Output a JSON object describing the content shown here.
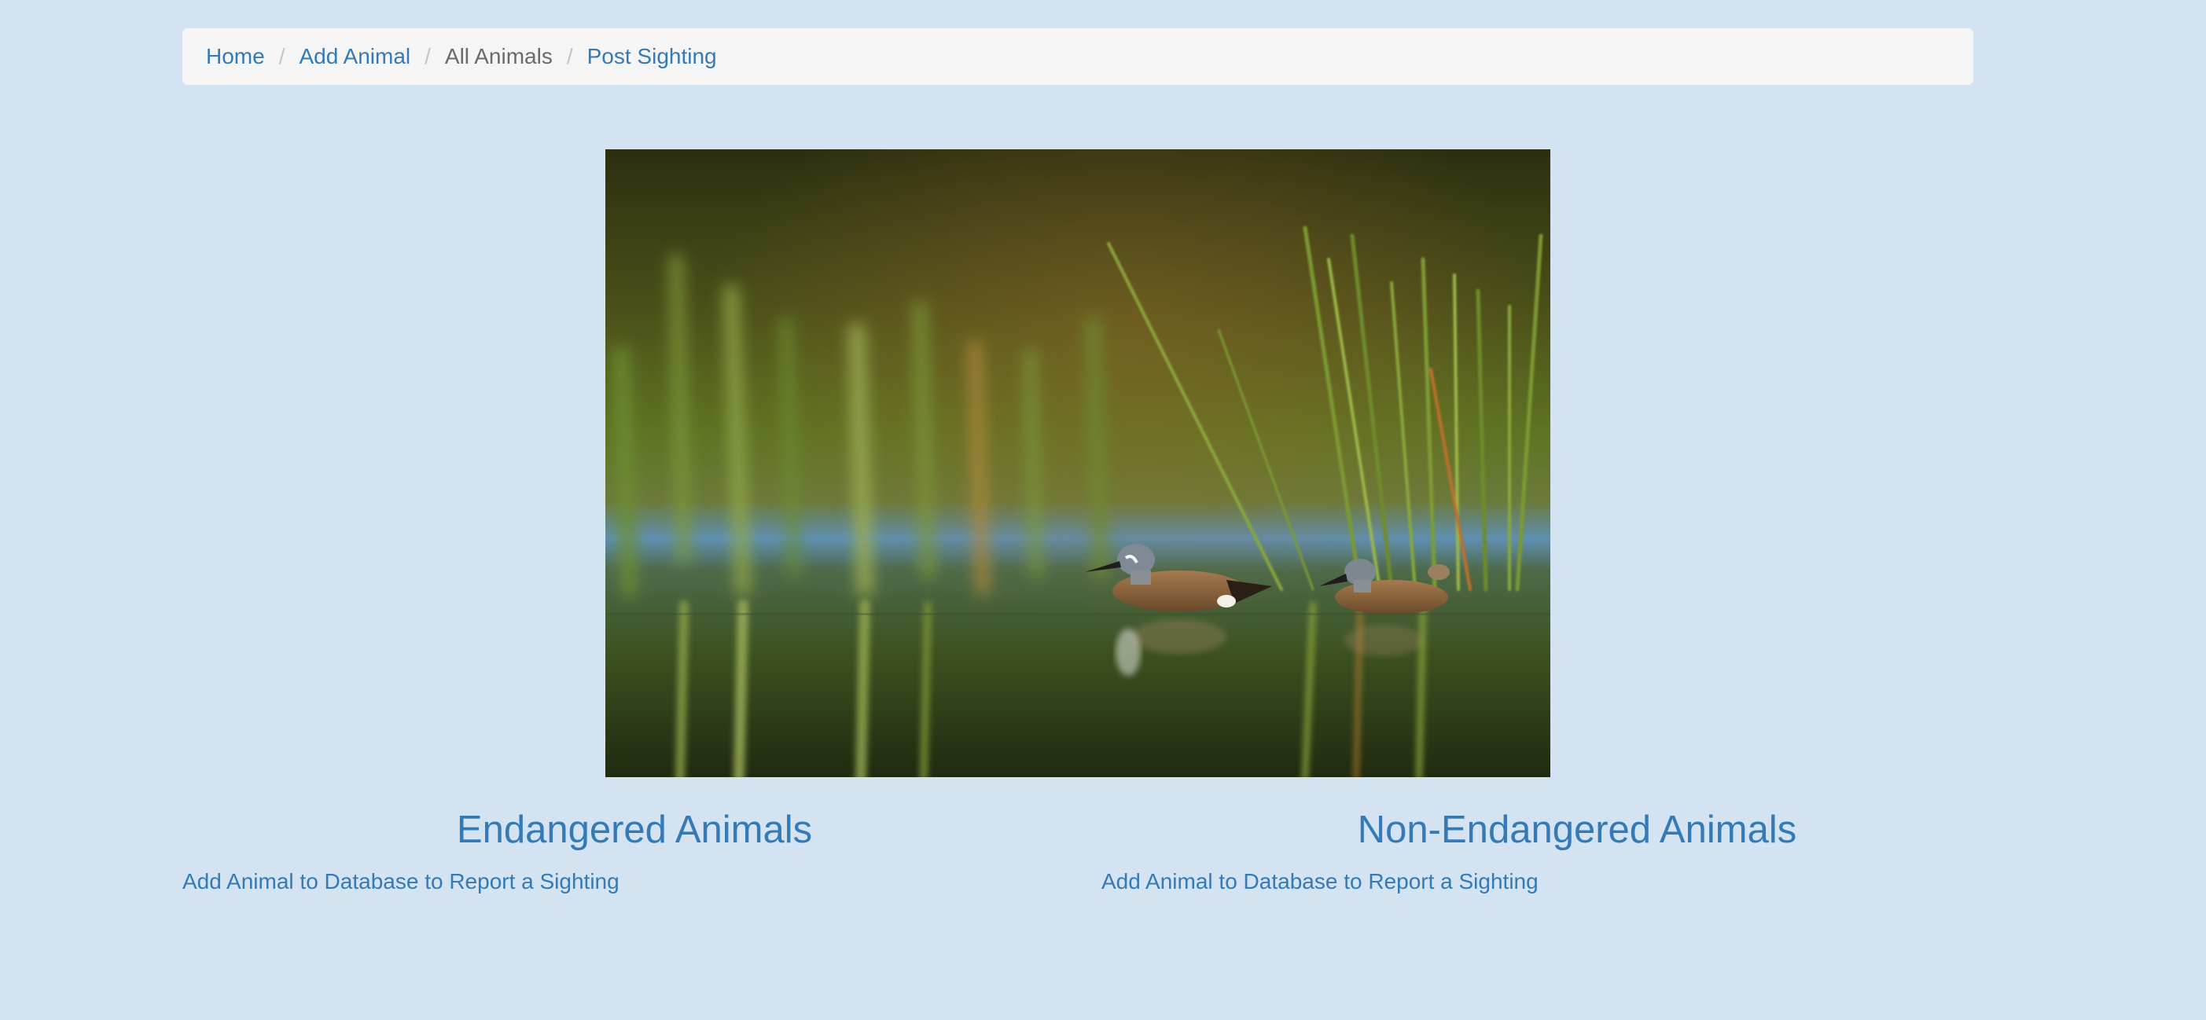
{
  "breadcrumb": {
    "items": [
      {
        "label": "Home",
        "active": false
      },
      {
        "label": "Add Animal",
        "active": false
      },
      {
        "label": "All Animals",
        "active": true
      },
      {
        "label": "Post Sighting",
        "active": false
      }
    ],
    "separator": "/"
  },
  "sections": {
    "endangered": {
      "title": "Endangered Animals",
      "link": "Add Animal to Database to Report a Sighting"
    },
    "non_endangered": {
      "title": "Non-Endangered Animals",
      "link": "Add Animal to Database to Report a Sighting"
    }
  },
  "colors": {
    "page_bg": "#d3e3f2",
    "link": "#337ab7",
    "breadcrumb_bg": "#f5f5f5",
    "breadcrumb_active": "#6a6a6a"
  }
}
